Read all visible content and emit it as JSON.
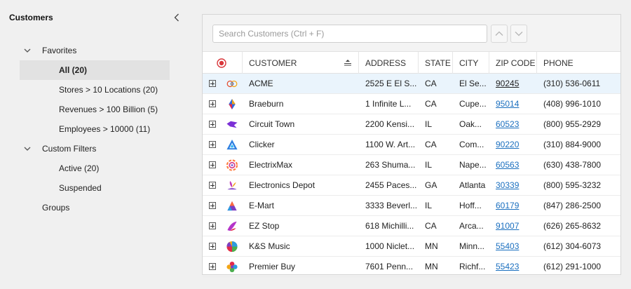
{
  "sidebar": {
    "title": "Customers",
    "tree": [
      {
        "label": "Favorites",
        "type": "group",
        "name": "tree-group-favorites"
      },
      {
        "label": "All (20)",
        "type": "child",
        "selected": true,
        "name": "tree-item-all"
      },
      {
        "label": "Stores > 10 Locations (20)",
        "type": "child",
        "name": "tree-item-stores"
      },
      {
        "label": "Revenues > 100 Billion (5)",
        "type": "child",
        "name": "tree-item-revenues"
      },
      {
        "label": "Employees > 10000 (11)",
        "type": "child",
        "name": "tree-item-employees"
      },
      {
        "label": "Custom Filters",
        "type": "group",
        "name": "tree-group-custom-filters"
      },
      {
        "label": "Active (20)",
        "type": "child",
        "name": "tree-item-active"
      },
      {
        "label": "Suspended",
        "type": "child",
        "name": "tree-item-suspended"
      },
      {
        "label": "Groups",
        "type": "root",
        "name": "tree-item-groups"
      }
    ]
  },
  "toolbar": {
    "search_placeholder": "Search Customers (Ctrl + F)",
    "search_value": ""
  },
  "columns": {
    "customer": "CUSTOMER",
    "address": "ADDRESS",
    "state": "STATE",
    "city": "CITY",
    "zip": "ZIP CODE",
    "phone": "PHONE"
  },
  "rows": [
    {
      "customer": "ACME",
      "address": "2525 E El S...",
      "state": "CA",
      "city": "El Se...",
      "zip": "90245",
      "phone": "(310) 536-0611",
      "logo": "acme-logo-icon",
      "focused": true
    },
    {
      "customer": "Braeburn",
      "address": "1 Infinite L...",
      "state": "CA",
      "city": "Cupe...",
      "zip": "95014",
      "phone": "(408) 996-1010",
      "logo": "braeburn-logo-icon"
    },
    {
      "customer": "Circuit Town",
      "address": "2200 Kensi...",
      "state": "IL",
      "city": "Oak...",
      "zip": "60523",
      "phone": "(800) 955-2929",
      "logo": "circuit-town-logo-icon"
    },
    {
      "customer": "Clicker",
      "address": "1100 W. Art...",
      "state": "CA",
      "city": "Com...",
      "zip": "90220",
      "phone": "(310) 884-9000",
      "logo": "clicker-logo-icon"
    },
    {
      "customer": "ElectrixMax",
      "address": "263 Shuma...",
      "state": "IL",
      "city": "Nape...",
      "zip": "60563",
      "phone": "(630) 438-7800",
      "logo": "electrixmax-logo-icon"
    },
    {
      "customer": "Electronics Depot",
      "address": "2455 Paces...",
      "state": "GA",
      "city": "Atlanta",
      "zip": "30339",
      "phone": "(800) 595-3232",
      "logo": "electronics-depot-logo-icon"
    },
    {
      "customer": "E-Mart",
      "address": "3333 Beverl...",
      "state": "IL",
      "city": "Hoff...",
      "zip": "60179",
      "phone": "(847) 286-2500",
      "logo": "emart-logo-icon"
    },
    {
      "customer": "EZ Stop",
      "address": "618 Michilli...",
      "state": "CA",
      "city": "Arca...",
      "zip": "91007",
      "phone": "(626) 265-8632",
      "logo": "ez-stop-logo-icon"
    },
    {
      "customer": "K&S Music",
      "address": "1000 Niclet...",
      "state": "MN",
      "city": "Minn...",
      "zip": "55403",
      "phone": "(612) 304-6073",
      "logo": "ks-music-logo-icon"
    },
    {
      "customer": "Premier Buy",
      "address": "7601 Penn...",
      "state": "MN",
      "city": "Richf...",
      "zip": "55423",
      "phone": "(612) 291-1000",
      "logo": "premier-buy-logo-icon"
    }
  ],
  "colors": {
    "accent": "#1a6fbf",
    "focused_row": "#eaf4fc",
    "selected_tree": "#e2e2e2",
    "header_icon": "#d9373b"
  }
}
